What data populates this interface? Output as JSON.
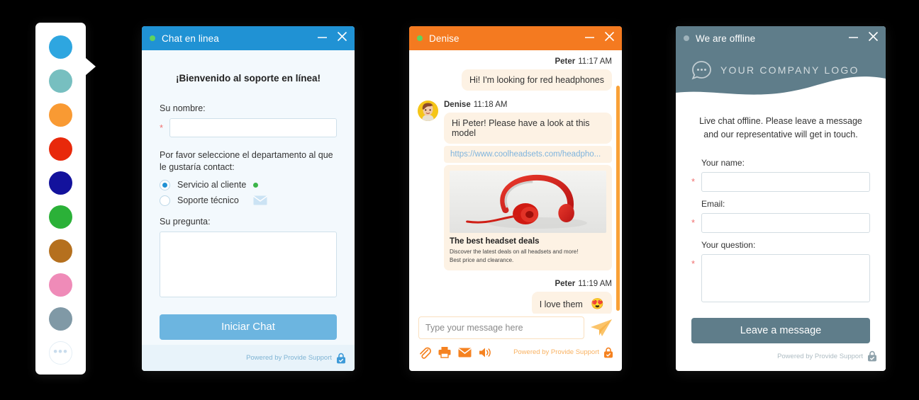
{
  "color_picker": {
    "swatches": [
      {
        "name": "blue",
        "color": "#2ea6e0"
      },
      {
        "name": "teal",
        "color": "#77bfc0"
      },
      {
        "name": "orange",
        "color": "#f99a33"
      },
      {
        "name": "red",
        "color": "#e8290b"
      },
      {
        "name": "navy",
        "color": "#13129c"
      },
      {
        "name": "green",
        "color": "#2bb138"
      },
      {
        "name": "brown",
        "color": "#b5701e"
      },
      {
        "name": "pink",
        "color": "#ef8bb8"
      },
      {
        "name": "slate",
        "color": "#8099a6"
      }
    ],
    "more_label": "•••"
  },
  "window1": {
    "title": "Chat en linea",
    "status": "online",
    "accent": "#2092d4",
    "minimize_label": "—",
    "close_label": "✕",
    "welcome": "¡Bienvenido al soporte en línea!",
    "name_label": "Su nombre:",
    "name_value": "",
    "name_placeholder": "",
    "required_mark": "*",
    "department_label": "Por favor seleccione el departamento al que le gustaría contact:",
    "options": [
      {
        "label": "Servicio al cliente",
        "selected": true,
        "badge": "online-dot"
      },
      {
        "label": "Soporte técnico",
        "selected": false,
        "badge": "mail-icon"
      }
    ],
    "question_label": "Su pregunta:",
    "question_value": "",
    "start_button": "Iniciar Chat",
    "powered_by": "Powered by Provide Support"
  },
  "window2": {
    "title": "Denise",
    "status": "online",
    "accent": "#f47a20",
    "minimize_label": "—",
    "close_label": "✕",
    "messages": [
      {
        "author": "Peter",
        "time": "11:17 AM",
        "side": "right",
        "text": "Hi! I'm looking for red headphones"
      },
      {
        "author": "Denise",
        "time": "11:18 AM",
        "side": "left",
        "text": "Hi Peter! Please have a look at this model",
        "link": "https://www.coolheadsets.com/headpho...",
        "card": {
          "title": "The best headset deals",
          "line1": "Discover the latest deals on all headsets and more!",
          "line2": "Best price and clearance."
        }
      },
      {
        "author": "Peter",
        "time": "11:19 AM",
        "side": "right",
        "text": "I love them",
        "emoji": "😍"
      }
    ],
    "input_placeholder": "Type your message here",
    "input_value": "",
    "send_icon": "paper-plane-icon",
    "tool_icons": [
      "paperclip-icon",
      "printer-icon",
      "email-icon",
      "sound-icon"
    ],
    "powered_by": "Powered by Provide Support"
  },
  "window3": {
    "title": "We are offline",
    "status": "offline",
    "accent": "#5f7d8a",
    "minimize_label": "—",
    "close_label": "✕",
    "logo_text": "YOUR COMPANY LOGO",
    "intro": "Live chat offline. Please leave a message and our representative will get in touch.",
    "required_mark": "*",
    "fields": [
      {
        "label": "Your name:",
        "value": "",
        "type": "text"
      },
      {
        "label": "Email:",
        "value": "",
        "type": "text"
      },
      {
        "label": "Your question:",
        "value": "",
        "type": "textarea"
      }
    ],
    "submit_button": "Leave a message",
    "powered_by": "Powered by Provide Support"
  }
}
